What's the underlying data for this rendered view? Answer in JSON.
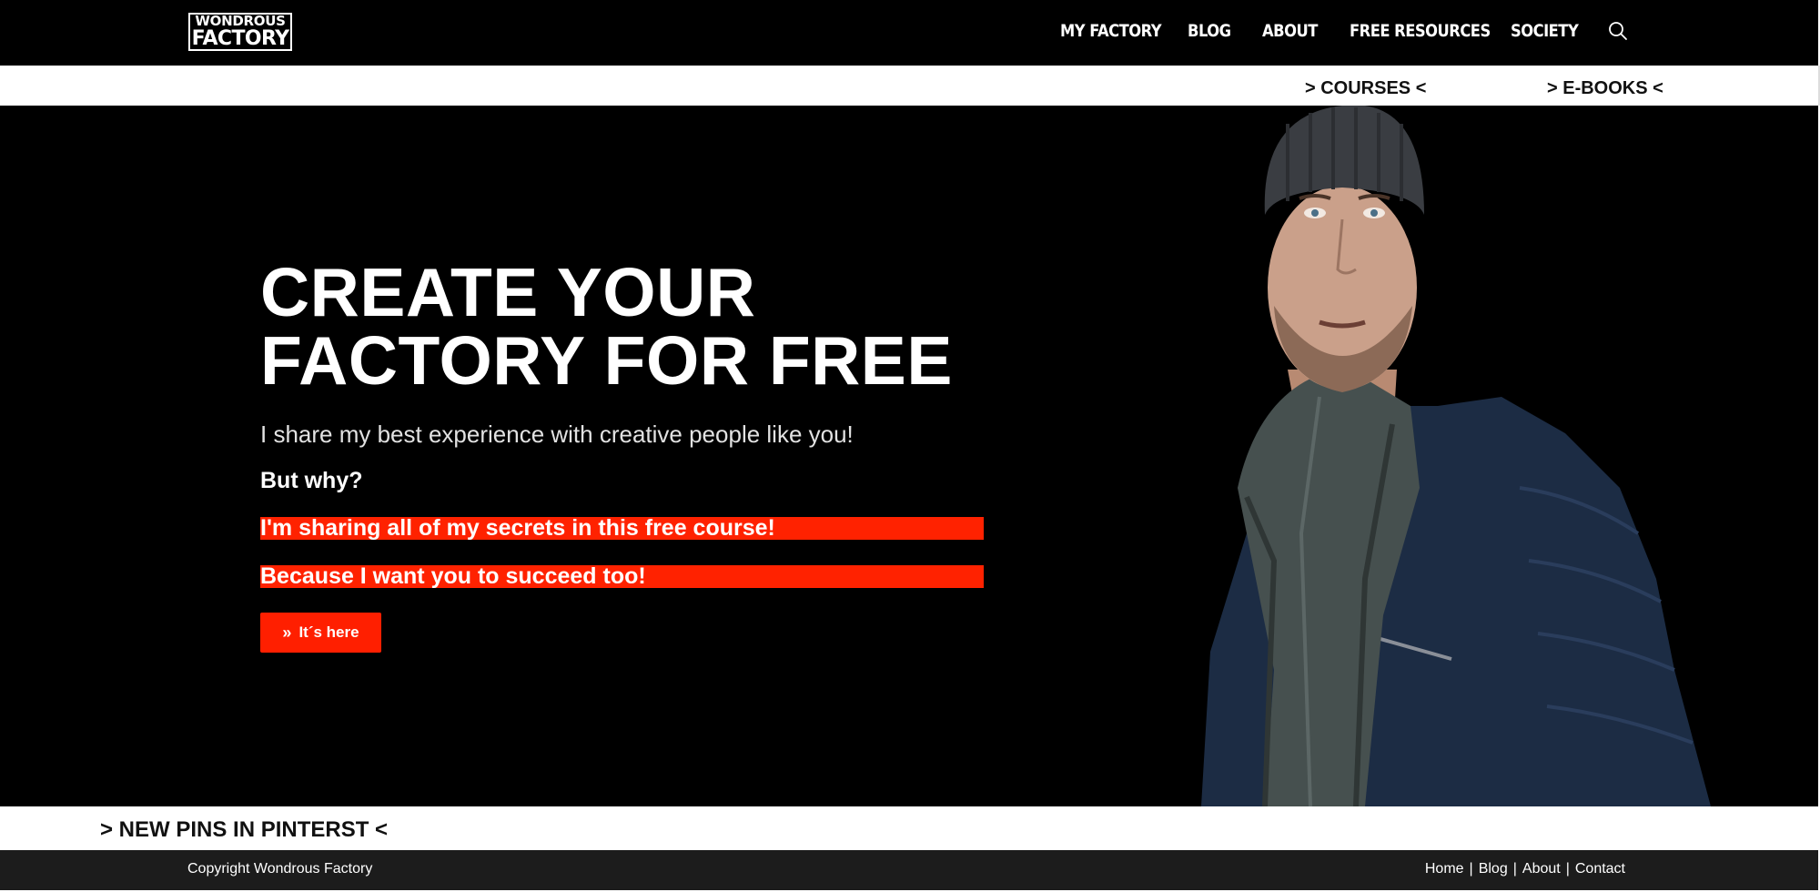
{
  "logo": {
    "line1": "WONDROUS",
    "line2": "FACTORY"
  },
  "nav": {
    "items": [
      {
        "label": "MY FACTORY"
      },
      {
        "label": "BLOG"
      },
      {
        "label": "ABOUT"
      },
      {
        "label": "FREE RESOURCES"
      },
      {
        "label": "SOCIETY"
      }
    ],
    "search_icon": "search-icon"
  },
  "subnav": {
    "courses": "> COURSES <",
    "ebooks": "> E-BOOKS <"
  },
  "hero": {
    "title": "CREATE YOUR\nFACTORY FOR FREE",
    "subtitle": "I share my best experience with creative people like you!",
    "why": "But why?",
    "highlight1": "I'm sharing all of my secrets in this free course!",
    "highlight2": "Because I want you to succeed too!",
    "cta_label": "It´s here",
    "cta_icon": "double-chevron-right-icon",
    "accent_color": "#ff2200"
  },
  "pins": {
    "label": "> NEW PINS IN PINTERST <"
  },
  "footer": {
    "copyright": "Copyright Wondrous Factory",
    "links": [
      "Home",
      "Blog",
      "About",
      "Contact"
    ],
    "separator": "|"
  }
}
